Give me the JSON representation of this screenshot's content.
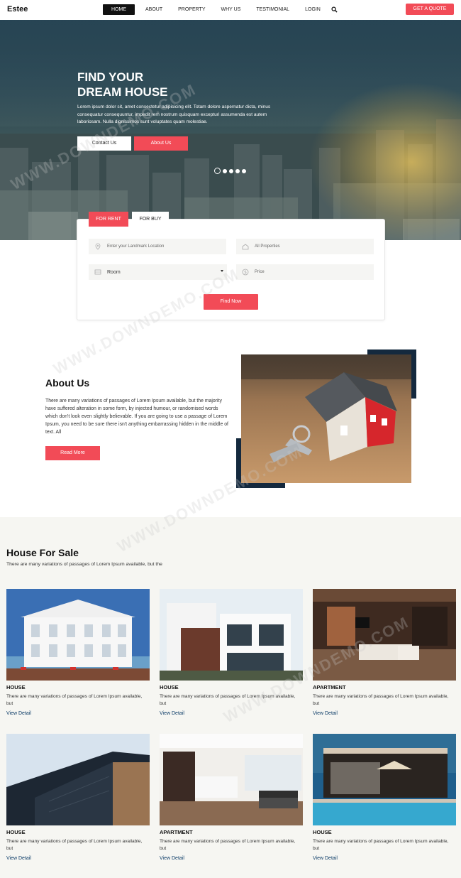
{
  "header": {
    "logo": "Estee",
    "nav": [
      {
        "label": "HOME",
        "active": true
      },
      {
        "label": "ABOUT"
      },
      {
        "label": "PROPERTY"
      },
      {
        "label": "WHY US"
      },
      {
        "label": "TESTIMONIAL"
      },
      {
        "label": "LOGIN"
      }
    ],
    "search_icon": "search-icon",
    "quote_button": "GET A QUOTE"
  },
  "hero": {
    "title_line1": "FIND YOUR",
    "title_line2": "DREAM HOUSE",
    "text": "Lorem ipsum dolor sit, amet consectetur adipisicing elit. Totam dolore aspernatur dicta, minus consequatur consequuntur, impedit rem nostrum quisquam excepturi assumenda est autem laboriosam. Nulla dignissimos sunt voluptates quam molestiae.",
    "contact_button": "Contact Us",
    "about_button": "About Us",
    "slide_count": 5,
    "active_slide": 1
  },
  "search": {
    "tabs": [
      {
        "label": "FOR RENT",
        "active": true
      },
      {
        "label": "FOR BUY",
        "active": false
      }
    ],
    "landmark_placeholder": "Enter your Landmark Location",
    "properties_placeholder": "All Properties",
    "room_value": "Room",
    "price_placeholder": "Price",
    "find_button": "Find Now"
  },
  "about": {
    "title": "About Us",
    "text": "There are many variations of passages of Lorem Ipsum available, but the majority have suffered alteration in some form, by injected humour, or randomised words which don't look even slightly believable. If you are going to use a passage of Lorem Ipsum, you need to be sure there isn't anything embarrassing hidden in the middle of text. All",
    "read_more": "Read More"
  },
  "listings": {
    "title": "House For Sale",
    "subtitle": "There are many variations of passages of Lorem Ipsum available, but the",
    "items": [
      {
        "type": "HOUSE",
        "desc": "There are many variations of passages of Lorem Ipsum available, but",
        "link": "View Detail"
      },
      {
        "type": "HOUSE",
        "desc": "There are many variations of passages of Lorem Ipsum available, but",
        "link": "View Detail"
      },
      {
        "type": "APARTMENT",
        "desc": "There are many variations of passages of Lorem Ipsum available, but",
        "link": "View Detail"
      },
      {
        "type": "HOUSE",
        "desc": "There are many variations of passages of Lorem Ipsum available, but",
        "link": "View Detail"
      },
      {
        "type": "APARTMENT",
        "desc": "There are many variations of passages of Lorem Ipsum available, but",
        "link": "View Detail"
      },
      {
        "type": "HOUSE",
        "desc": "There are many variations of passages of Lorem Ipsum available, but",
        "link": "View Detail"
      }
    ]
  },
  "watermark": "WWW.DOWNDEMO.COM",
  "colors": {
    "accent": "#f24b57",
    "dark_navy": "#14293e",
    "section_bg": "#f6f6f2"
  }
}
